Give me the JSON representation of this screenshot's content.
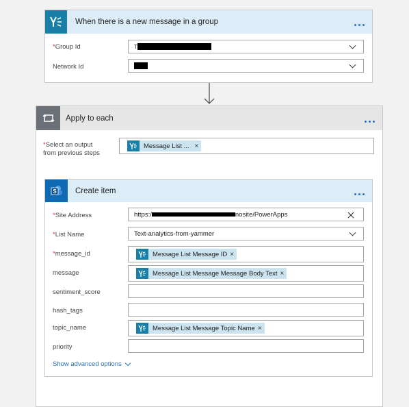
{
  "trigger": {
    "title": "When there is a new message in a group",
    "icon": "yammer-icon",
    "fields": {
      "group_id": {
        "label": "Group Id",
        "value": "T"
      },
      "network_id": {
        "label": "Network Id",
        "value": ""
      }
    }
  },
  "arrow_icon": "down-arrow-icon",
  "apply_each": {
    "title": "Apply to each",
    "icon": "loop-icon",
    "select_label_line1": "Select an output",
    "select_label_line2": "from previous steps",
    "select_token": "Message List ...",
    "create_item": {
      "title": "Create item",
      "icon": "sharepoint-icon",
      "fields": {
        "site_address": {
          "label": "Site Address",
          "value_prefix": "https:/",
          "value_suffix": "nosite/PowerApps"
        },
        "list_name": {
          "label": "List Name",
          "value": "Text-analytics-from-yammer"
        },
        "message_id": {
          "label": "message_id",
          "token": "Message List Message ID"
        },
        "message": {
          "label": "message",
          "token": "Message List Message Message Body Text"
        },
        "sentiment_score": {
          "label": "sentiment_score"
        },
        "hash_tags": {
          "label": "hash_tags"
        },
        "topic_name": {
          "label": "topic_name",
          "token": "Message List Message Topic Name"
        },
        "priority": {
          "label": "priority"
        }
      },
      "advanced_label": "Show advanced options"
    }
  },
  "colors": {
    "yammer": "#1a7fa6",
    "sharepoint": "#0f6ab4",
    "header_blue": "#dcedf8",
    "header_gray": "#e6e6e6",
    "accent": "#2a6ebb",
    "required": "#d13438"
  }
}
